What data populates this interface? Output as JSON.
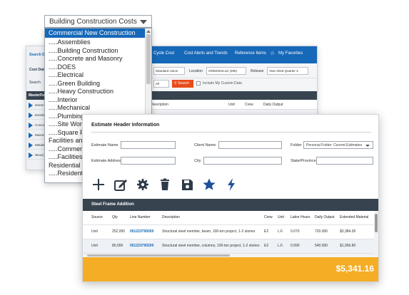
{
  "colors": {
    "nav_blue": "#1668b8",
    "dark_bar": "#37434f",
    "accent_orange": "#e74c1b",
    "total_yellow": "#f5ad25"
  },
  "background_app": {
    "left_search_label": "Search D",
    "left_cost_data_label": "Cost Data",
    "left_search_field_label": "Search",
    "left_masterformat_label": "MasterFo",
    "nav": [
      {
        "label": "ife Cycle Cost"
      },
      {
        "label": "Cost Alerts and Trends"
      },
      {
        "label": "Reference Items"
      },
      {
        "label": "My Favorites",
        "icon": "star-icon"
      }
    ],
    "filters": {
      "labor_label": "e",
      "labor_value": "Standard Union",
      "location_label": "Location",
      "location_value": "GREENVILLE (296)",
      "release_label": "Release",
      "release_value": "Year 2018 Quarter 3"
    },
    "type_value": "All",
    "search_button": "Search",
    "include_custom_label": "Include My Custom Data",
    "left_tree": [
      {
        "label": "Gener"
      },
      {
        "label": "Existin"
      },
      {
        "label": "Concre"
      },
      {
        "label": "Mason"
      },
      {
        "label": "Metals"
      },
      {
        "label": "Wood,"
      }
    ],
    "table_headers": [
      "Description",
      "Unit",
      "Crew",
      "Daily Output"
    ]
  },
  "dropdown": {
    "selected_value": "Building Construction Costs",
    "items": [
      {
        "label": "Commercial New Construction",
        "selected": true
      },
      {
        "label": ".....Assemblies",
        "selected": false
      },
      {
        "label": ".....Building Construction",
        "selected": false
      },
      {
        "label": ".....Concrete and Masonry",
        "selected": false
      },
      {
        "label": ".....DOES",
        "selected": false
      },
      {
        "label": ".....Electrical",
        "selected": false
      },
      {
        "label": ".....Green Building",
        "selected": false
      },
      {
        "label": ".....Heavy Construction",
        "selected": false
      },
      {
        "label": ".....Interior",
        "selected": false
      },
      {
        "label": ".....Mechanical",
        "selected": false
      },
      {
        "label": ".....Plumbing",
        "selected": false
      },
      {
        "label": ".....Site Work",
        "selected": false
      },
      {
        "label": ".....Square F",
        "selected": false
      },
      {
        "label": "Facilities and",
        "selected": false
      },
      {
        "label": ".....Commerci",
        "selected": false
      },
      {
        "label": ".....Facilities",
        "selected": false
      },
      {
        "label": "Residential I",
        "selected": false
      },
      {
        "label": ".....Residenti",
        "selected": false
      }
    ]
  },
  "estimate_panel": {
    "title": "Estimate Header Information",
    "fields": {
      "estimate_name_label": "Estimate Name",
      "client_name_label": "Client Name",
      "folder_label": "Folder",
      "folder_value": "Personal Folder: Current Estimates",
      "estimate_address_label": "Estimate Address",
      "city_label": "City",
      "state_label": "State/Province"
    },
    "toolbar": [
      {
        "name": "add-icon"
      },
      {
        "name": "edit-icon"
      },
      {
        "name": "settings-icon"
      },
      {
        "name": "delete-icon"
      },
      {
        "name": "save-icon"
      },
      {
        "name": "favorite-icon"
      },
      {
        "name": "lightning-icon"
      }
    ],
    "section_title": "Steel Frame Addition",
    "table": {
      "headers": [
        "Source",
        "Qty",
        "Line Number",
        "Description",
        "Crew",
        "Unit",
        "Labor Hours",
        "Daily Output",
        "Extended Material"
      ],
      "rows": [
        {
          "source": "Unit",
          "qty": "252,000",
          "line_number": "051223790050",
          "description": "Structural steel member, beam, 100-ton project, 1-2 stories",
          "crew": "E2",
          "unit": "L.F.",
          "labor_hours": "0.070",
          "daily_output": "720.000",
          "extended_material": "$3,384.36"
        },
        {
          "source": "Unit",
          "qty": "80,000",
          "line_number": "051223790200",
          "description": "Structural steel member, columns, 100-ton project, 1-2 stories",
          "crew": "E2",
          "unit": "L.F.",
          "labor_hours": "0.990",
          "daily_output": "540.000",
          "extended_material": "$1,956.80"
        }
      ]
    },
    "total": "$5,341.16"
  }
}
